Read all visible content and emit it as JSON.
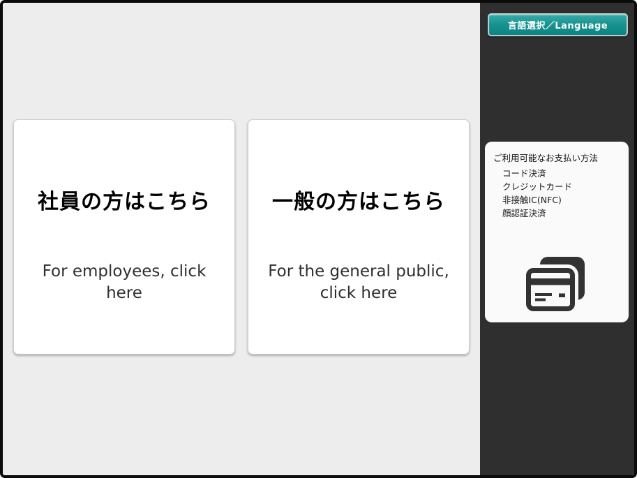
{
  "colors": {
    "main_background": "#ededed",
    "sidebar_background": "#2f2f2f",
    "card_background": "#ffffff",
    "language_button_teal": "#17918f",
    "icon_dark": "#333333",
    "screen_border": "#0b0b0b"
  },
  "main": {
    "cards": [
      {
        "title": "社員の方はこちら",
        "subtitle": "For employees, click here"
      },
      {
        "title": "一般の方はこちら",
        "subtitle": "For the general public, click here"
      }
    ]
  },
  "sidebar": {
    "language_button_label": "言語選択／Language",
    "payment_panel": {
      "header": "ご利用可能なお支払い方法",
      "methods": [
        "コード決済",
        "クレジットカード",
        "非接触IC(NFC)",
        "顔認証決済"
      ],
      "icon": "credit-card-icon"
    }
  }
}
